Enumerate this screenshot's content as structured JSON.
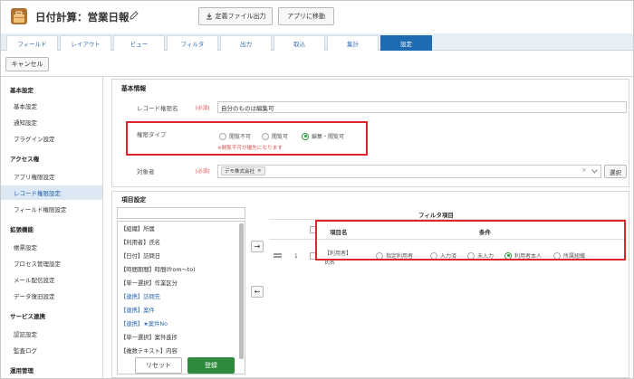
{
  "header": {
    "title": "日付計算：営業日報",
    "app_icon": "briefcase-icon",
    "edit_icon": "pencil-icon",
    "export_button": "定義ファイル出力",
    "move_button": "アプリに移動"
  },
  "tabs": [
    "フィールド",
    "レイアウト",
    "ビュー",
    "フィルタ",
    "出力",
    "取込",
    "集計",
    "設定"
  ],
  "active_tab": "設定",
  "cancel_button": "キャンセル",
  "sidebar": {
    "sections": [
      {
        "title": "基本設定",
        "items": [
          "基本設定",
          "通知設定",
          "プラグイン設定"
        ]
      },
      {
        "title": "アクセス権",
        "items": [
          "アプリ権限設定",
          "レコード権限設定",
          "フィールド権限設定"
        ]
      },
      {
        "title": "拡張機能",
        "items": [
          "帳票設定",
          "プロセス管理設定",
          "メール配信設定",
          "データ復旧設定"
        ]
      },
      {
        "title": "サービス連携",
        "items": [
          "認証設定",
          "監査ログ"
        ]
      },
      {
        "title": "運用管理",
        "items": []
      }
    ],
    "active_item": "レコード権限設定"
  },
  "basic_info": {
    "title": "基本情報",
    "name_label": "レコード権限名",
    "required": "[必須]",
    "name_value": "自分のものは編集可",
    "type_label": "権限タイプ",
    "type_options": [
      "閲覧不可",
      "閲覧可",
      "編集・閲覧可"
    ],
    "type_selected": "編集・閲覧可",
    "type_warning": "※閲覧不可が優先になります",
    "target_label": "対象者",
    "target_tag": "デモ株式会社",
    "target_tag_remove": "×",
    "clear_glyph": "×",
    "select_button": "選択"
  },
  "item_settings": {
    "title": "項目設定",
    "search_value": "",
    "fields": [
      {
        "label": "【組織】所属",
        "link": false
      },
      {
        "label": "【利用者】氏名",
        "link": false
      },
      {
        "label": "【日付】訪問日",
        "link": false
      },
      {
        "label": "【時間期間】時間(from〜to)",
        "link": false
      },
      {
        "label": "【単一選択】作業区分",
        "link": false
      },
      {
        "label": "【連携】訪問先",
        "link": true
      },
      {
        "label": "【連携】案件",
        "link": true
      },
      {
        "label": "【連携】★案件No",
        "link": true
      },
      {
        "label": "【単一選択】案件進捗",
        "link": false
      },
      {
        "label": "【複数テキスト】内容",
        "link": false
      }
    ],
    "add_arrow": "→",
    "remove_arrow": "←"
  },
  "filter": {
    "title": "フィルタ項目",
    "col_item": "項目名",
    "col_condition": "条件",
    "rows": [
      {
        "no": "1",
        "item_line1": "【利用者】",
        "item_line2": "氏名",
        "options": [
          "指定利用者",
          "入力済",
          "未入力",
          "利用者本人",
          "所属組織"
        ],
        "selected": "利用者本人"
      }
    ]
  },
  "footer": {
    "reset_button": "リセット",
    "save_button": "登録"
  },
  "colors": {
    "accent": "#1f6bb2",
    "save": "#2e8b3d",
    "highlight": "#e0242a",
    "required": "#d9534f"
  }
}
